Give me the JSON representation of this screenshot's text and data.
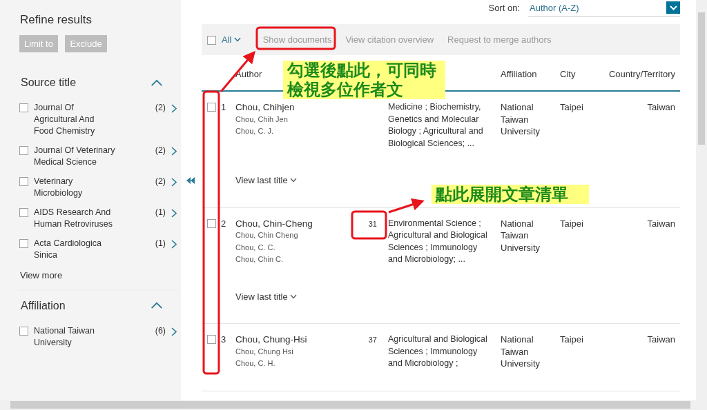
{
  "sidebar": {
    "title": "Refine results",
    "buttons": [
      {
        "label": "Limit to",
        "disabled": true
      },
      {
        "label": "Exclude",
        "disabled": true
      }
    ],
    "sections": [
      {
        "title": "Source title",
        "expanded": true,
        "items": [
          {
            "label": "Journal Of Agricultural And Food Chemistry",
            "count": "(2)",
            "checked": false
          },
          {
            "label": "Journal Of Veterinary Medical Science",
            "count": "(2)",
            "checked": false
          },
          {
            "label": "Veterinary Microbiology",
            "count": "(2)",
            "checked": false
          },
          {
            "label": "AIDS Research And Human Retroviruses",
            "count": "(1)",
            "checked": false
          },
          {
            "label": "Acta Cardiologica Sinica",
            "count": "(1)",
            "checked": false
          }
        ],
        "more": "View more"
      },
      {
        "title": "Affiliation",
        "expanded": true,
        "items": [
          {
            "label": "National Taiwan University",
            "count": "(6)",
            "checked": false
          }
        ]
      }
    ]
  },
  "sort": {
    "label": "Sort on:",
    "value": "Author (A-Z)"
  },
  "toolbar": {
    "select_all": {
      "label": "All",
      "checked": false
    },
    "actions": [
      {
        "label": "Show documents",
        "disabled": true
      },
      {
        "label": "View citation overview",
        "disabled": true
      },
      {
        "label": "Request to merge authors",
        "disabled": true
      }
    ]
  },
  "table": {
    "header": {
      "author": "Author",
      "affiliation": "Affiliation",
      "city": "City",
      "country": "Country/Territory"
    },
    "rows": [
      {
        "number": "1",
        "selected": false,
        "name": "Chou, Chihjen",
        "name_variants": [
          "Chou, Chih Jen",
          "Chou, C. J."
        ],
        "subject_areas": "Medicine ; Biochemistry, Genetics and Molecular Biology ; Agricultural and Biological Sciences; ...",
        "affiliation": "National Taiwan University",
        "city": "Taipei",
        "country": "Taiwan",
        "view_last_title": "View last title"
      },
      {
        "number": "2",
        "selected": false,
        "name": "Chou, Chin-Cheng",
        "name_variants": [
          "Chou, Chin Cheng",
          "Chou, C. C.",
          "Chou, Chin C."
        ],
        "documents": "31",
        "subject_areas": "Environmental Science ; Agricultural and Biological Sciences ; Immunology and Microbiology; ...",
        "affiliation": "National Taiwan University",
        "city": "Taipei",
        "country": "Taiwan",
        "view_last_title": "View last title"
      },
      {
        "number": "3",
        "selected": false,
        "name": "Chou, Chung-Hsi",
        "name_variants": [
          "Chou, Chung Hsi",
          "Chou, C. H."
        ],
        "documents": "37",
        "subject_areas": "Agricultural and Biological Sciences ; Immunology and Microbiology ;",
        "affiliation": "National Taiwan University",
        "city": "Taipei",
        "country": "Taiwan"
      }
    ]
  },
  "annotations": [
    {
      "kind": "callout",
      "text": "勾選後點此，可同時檢視多位作者文"
    },
    {
      "kind": "callout",
      "text": "點此展開文章清單"
    }
  ]
}
